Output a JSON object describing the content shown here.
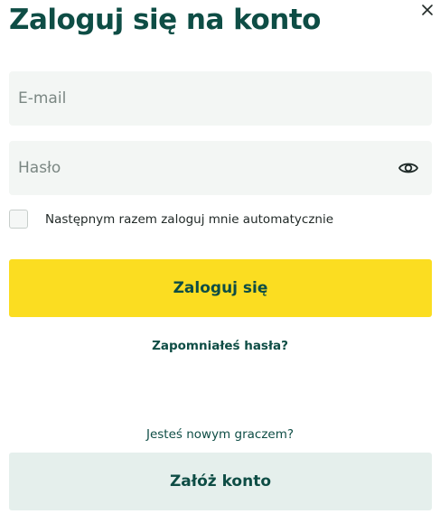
{
  "modal": {
    "title": "Zaloguj się na konto",
    "close_icon": "close-icon"
  },
  "form": {
    "email": {
      "placeholder": "E-mail",
      "value": ""
    },
    "password": {
      "placeholder": "Hasło",
      "value": "",
      "toggle_icon": "eye-icon"
    },
    "remember_me": {
      "label": "Następnym razem zaloguj mnie automatycznie",
      "checked": false
    },
    "submit_label": "Zaloguj się",
    "forgot_password_label": "Zapomniałeś hasła?"
  },
  "register": {
    "prompt": "Jesteś nowym graczem?",
    "button_label": "Załóż konto"
  },
  "colors": {
    "accent_yellow": "#fbdd21",
    "brand_green": "#0e4d45",
    "field_background": "#f3f6f4",
    "secondary_button": "#e5efec"
  }
}
